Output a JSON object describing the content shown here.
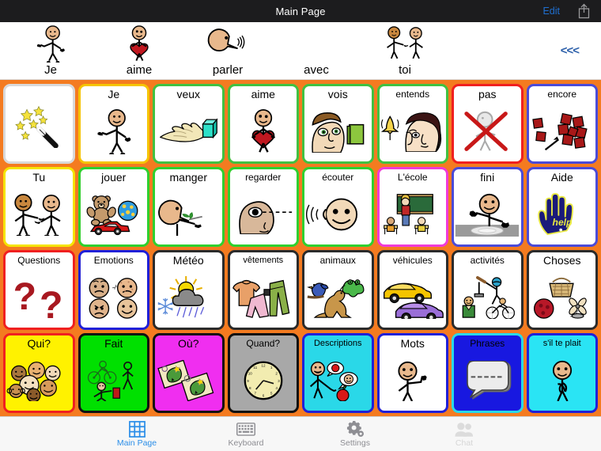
{
  "navbar": {
    "title": "Main Page",
    "edit_label": "Edit",
    "share_icon": "share-icon"
  },
  "sentence_bar": {
    "back_label": "<<<",
    "items": [
      {
        "label": "Je",
        "art": "person-pointing-self"
      },
      {
        "label": "aime",
        "art": "person-hugging-heart"
      },
      {
        "label": "parler",
        "art": "head-speaking"
      },
      {
        "label": "avec",
        "art": "none"
      },
      {
        "label": "toi",
        "art": "two-people-pointing"
      }
    ]
  },
  "grid": {
    "rows": [
      [
        {
          "label": "",
          "art": "magic-wand-stars",
          "border": "#d9d9d9",
          "bg": "#ffffff",
          "text": "#000000"
        },
        {
          "label": "Je",
          "art": "person-pointing-self",
          "border": "#f5c400",
          "bg": "#ffffff",
          "text": "#000000"
        },
        {
          "label": "veux",
          "art": "hand-reaching-cube",
          "border": "#41c141",
          "bg": "#ffffff",
          "text": "#000000"
        },
        {
          "label": "aime",
          "art": "person-hugging-heart",
          "border": "#41c141",
          "bg": "#ffffff",
          "text": "#000000"
        },
        {
          "label": "vois",
          "art": "face-looking-book",
          "border": "#41c141",
          "bg": "#ffffff",
          "text": "#000000"
        },
        {
          "label": "entends",
          "art": "bell-and-ear-face",
          "border": "#41c141",
          "bg": "#ffffff",
          "text": "#000000"
        },
        {
          "label": "pas",
          "art": "crossed-out-person",
          "border": "#f02020",
          "bg": "#ffffff",
          "text": "#000000"
        },
        {
          "label": "encore",
          "art": "more-red-blocks",
          "border": "#4b4bd8",
          "bg": "#ffffff",
          "text": "#000000"
        }
      ],
      [
        {
          "label": "Tu",
          "art": "two-people-pointing",
          "border": "#f5e400",
          "bg": "#ffffff",
          "text": "#000000"
        },
        {
          "label": "jouer",
          "art": "toys-bear-ball-car",
          "border": "#2fd02f",
          "bg": "#ffffff",
          "text": "#000000"
        },
        {
          "label": "manger",
          "art": "person-eating-fork",
          "border": "#2fd02f",
          "bg": "#ffffff",
          "text": "#000000"
        },
        {
          "label": "regarder",
          "art": "eye-looking",
          "border": "#2fd02f",
          "bg": "#ffffff",
          "text": "#000000"
        },
        {
          "label": "écouter",
          "art": "face-listening",
          "border": "#2fd02f",
          "bg": "#ffffff",
          "text": "#000000"
        },
        {
          "label": "L'école",
          "art": "classroom-scene",
          "border": "#f03ad8",
          "bg": "#ffffff",
          "text": "#000000"
        },
        {
          "label": "fini",
          "art": "person-empty-plate",
          "border": "#4b4bd8",
          "bg": "#ffffff",
          "text": "#000000"
        },
        {
          "label": "Aide",
          "art": "blue-help-hand",
          "border": "#4b4bd8",
          "bg": "#ffffff",
          "text": "#000000"
        }
      ],
      [
        {
          "label": "Questions",
          "art": "two-question-marks",
          "border": "#f02020",
          "bg": "#ffffff",
          "text": "#000000"
        },
        {
          "label": "Emotions",
          "art": "four-emotion-faces",
          "border": "#2020d8",
          "bg": "#ffffff",
          "text": "#000000"
        },
        {
          "label": "Météo",
          "art": "sun-cloud-rain-snow",
          "border": "#2b2b2b",
          "bg": "#ffffff",
          "text": "#000000"
        },
        {
          "label": "vêtements",
          "art": "shirt-and-pants",
          "border": "#2b2b2b",
          "bg": "#ffffff",
          "text": "#000000"
        },
        {
          "label": "animaux",
          "art": "bird-frog-kangaroo",
          "border": "#2b2b2b",
          "bg": "#ffffff",
          "text": "#000000"
        },
        {
          "label": "véhicules",
          "art": "two-cars",
          "border": "#2b2b2b",
          "bg": "#ffffff",
          "text": "#000000"
        },
        {
          "label": "activités",
          "art": "sports-and-bike",
          "border": "#2b2b2b",
          "bg": "#ffffff",
          "text": "#000000"
        },
        {
          "label": "Choses",
          "art": "basket-ball-fan",
          "border": "#2b2b2b",
          "bg": "#ffffff",
          "text": "#000000"
        }
      ],
      [
        {
          "label": "Qui?",
          "art": "crowd-of-faces",
          "border": "#f02020",
          "bg": "#fff200",
          "text": "#000000"
        },
        {
          "label": "Fait",
          "art": "people-doing",
          "border": "#111111",
          "bg": "#00e000",
          "text": "#000000"
        },
        {
          "label": "Où?",
          "art": "two-maps",
          "border": "#111111",
          "bg": "#f02ef0",
          "text": "#000000"
        },
        {
          "label": "Quand?",
          "art": "clock-face",
          "border": "#111111",
          "bg": "#a8a8a8",
          "text": "#000000"
        },
        {
          "label": "Descriptions",
          "art": "person-describing",
          "border": "#2020d8",
          "bg": "#2ad8e8",
          "text": "#000000"
        },
        {
          "label": "Mots",
          "art": "person-waving",
          "border": "#2020d8",
          "bg": "#ffffff",
          "text": "#000000"
        },
        {
          "label": "Phrases",
          "art": "speech-bubble",
          "border": "#2ad8e8",
          "bg": "#1818e0",
          "text": "#000000"
        },
        {
          "label": "s'il te plait",
          "art": "person-please",
          "border": "#2020d8",
          "bg": "#2ae4f4",
          "text": "#000000"
        }
      ]
    ]
  },
  "tabbar": {
    "tabs": [
      {
        "label": "Main Page",
        "icon": "grid-icon",
        "state": "active"
      },
      {
        "label": "Keyboard",
        "icon": "keyboard-icon",
        "state": "inactive"
      },
      {
        "label": "Settings",
        "icon": "gear-icon",
        "state": "inactive"
      },
      {
        "label": "Chat",
        "icon": "people-icon",
        "state": "disabled"
      }
    ]
  },
  "colors": {
    "grid_background": "#f47b20",
    "navbar_background": "#1c1c1e",
    "accent_blue": "#2b8ee8"
  }
}
